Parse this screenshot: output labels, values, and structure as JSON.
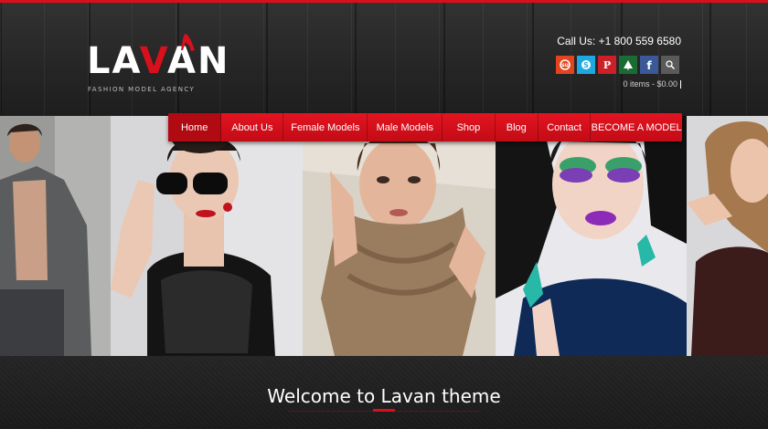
{
  "brand": {
    "logo_pre": "LA",
    "logo_v": "V",
    "logo_post": "AN",
    "tagline": "FASHION MODEL AGENCY",
    "accent_color": "#d8101c"
  },
  "header": {
    "call_us": "Call Us: +1 800 559 6580",
    "cart_text": "0 items - $0.00"
  },
  "social": [
    {
      "name": "stumbleupon-icon",
      "glyph": "su",
      "color": "#e4431e"
    },
    {
      "name": "skype-icon",
      "glyph": "S",
      "color": "#1ea8e0"
    },
    {
      "name": "pinterest-icon",
      "glyph": "P",
      "color": "#cb2027"
    },
    {
      "name": "tree-icon",
      "glyph": "▲",
      "color": "#1b6b34"
    },
    {
      "name": "facebook-icon",
      "glyph": "f",
      "color": "#3b5998"
    },
    {
      "name": "search-icon",
      "glyph": "⌕",
      "color": "#5a5a5a"
    }
  ],
  "nav": {
    "items": [
      {
        "label": "Home"
      },
      {
        "label": "About Us"
      },
      {
        "label": "Female Models"
      },
      {
        "label": "Male Models"
      },
      {
        "label": "Shop"
      },
      {
        "label": "Blog"
      },
      {
        "label": "Contact"
      },
      {
        "label": "BECOME A MODEL"
      }
    ]
  },
  "welcome": {
    "title": "Welcome to Lavan theme"
  }
}
